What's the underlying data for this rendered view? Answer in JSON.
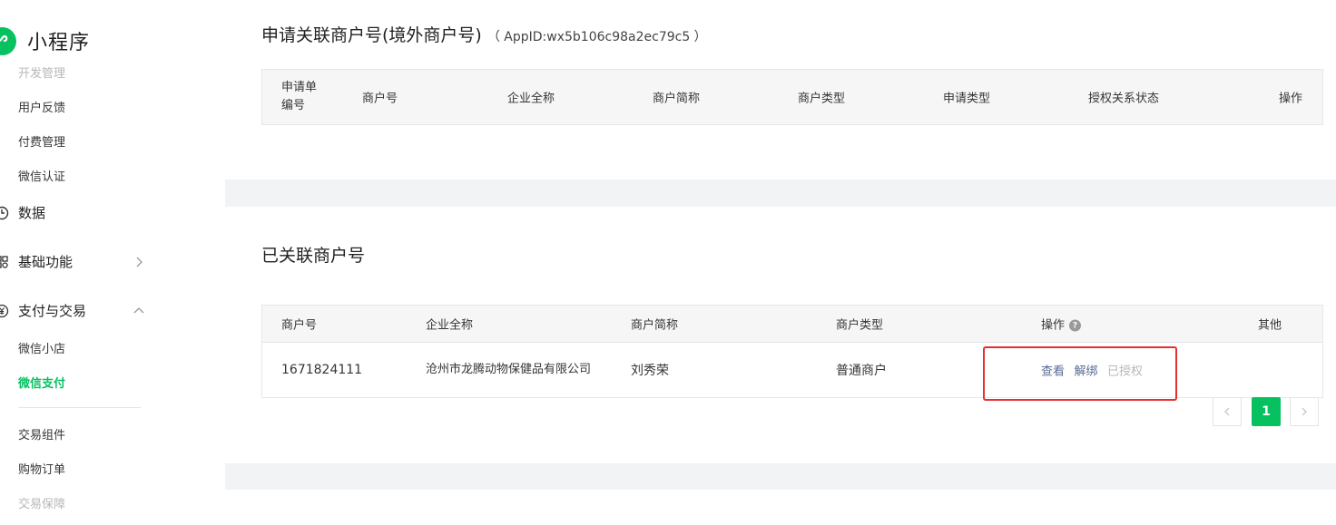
{
  "app": {
    "title": "小程序"
  },
  "sidebar": {
    "top_partial_label": "开发管理",
    "items_dev": [
      "用户反馈",
      "付费管理",
      "微信认证"
    ],
    "group_data": "数据",
    "group_basic": "基础功能",
    "group_pay": "支付与交易",
    "pay_items": [
      "微信小店",
      "微信支付"
    ],
    "trade_items": [
      "交易组件",
      "购物订单",
      "交易保障"
    ]
  },
  "apply_section": {
    "title": "申请关联商户号(境外商户号)",
    "appid": "（ AppID:wx5b106c98a2ec79c5 ）",
    "columns": [
      "申请单编号",
      "商户号",
      "企业全称",
      "商户简称",
      "商户类型",
      "申请类型",
      "授权关系状态",
      "操作"
    ]
  },
  "linked_section": {
    "title": "已关联商户号",
    "columns": [
      "商户号",
      "企业全称",
      "商户简称",
      "商户类型",
      "操作",
      "其他"
    ],
    "rows": [
      {
        "merchant_id": "1671824111",
        "company": "沧州市龙腾动物保健品有限公司",
        "short_name": "刘秀荣",
        "type": "普通商户",
        "actions": {
          "view": "查看",
          "unbind": "解绑",
          "authorized": "已授权"
        },
        "other": ""
      }
    ],
    "pagination": {
      "current": "1"
    }
  },
  "colors": {
    "accent": "#07c160",
    "link": "#576b95",
    "highlight": "#e5302e"
  }
}
